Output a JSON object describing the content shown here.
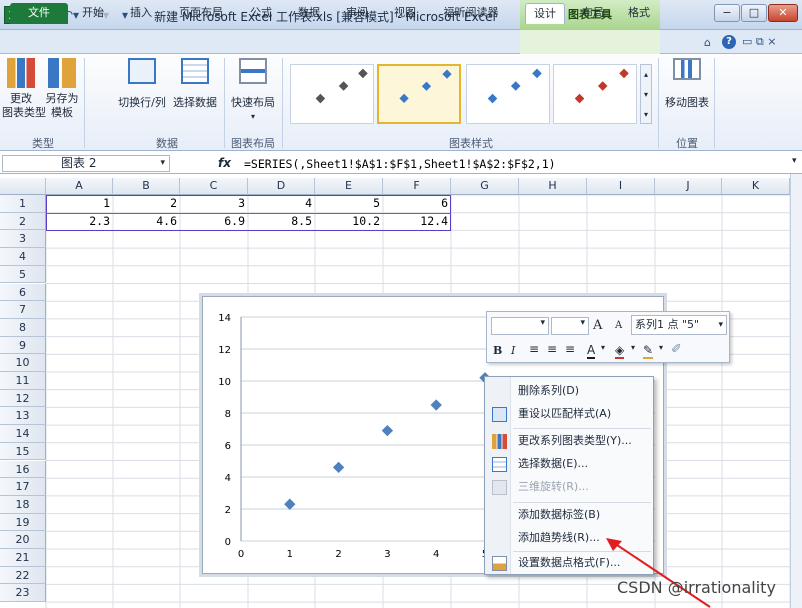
{
  "window": {
    "title": "新建 Microsoft Excel 工作表.xls  [兼容模式] - Microsoft Excel",
    "context_tools": "图表工具",
    "minimize": "−",
    "maximize": "□",
    "close": "✕"
  },
  "tabs": [
    {
      "label": "文件"
    },
    {
      "label": "开始"
    },
    {
      "label": "插入"
    },
    {
      "label": "页面布局"
    },
    {
      "label": "公式"
    },
    {
      "label": "数据"
    },
    {
      "label": "审阅"
    },
    {
      "label": "视图"
    },
    {
      "label": "福昕阅读器"
    },
    {
      "label": "设计"
    },
    {
      "label": "布局"
    },
    {
      "label": "格式"
    }
  ],
  "ribbon": {
    "change_type": "更改\n图表类型",
    "save_template": "另存为\n模板",
    "switch_rowcol": "切换行/列",
    "select_data": "选择数据",
    "quick_layout": "快速布局",
    "move_chart": "移动图表",
    "groups": {
      "type": "类型",
      "data": "数据",
      "layout": "图表布局",
      "styles": "图表样式",
      "location": "位置"
    }
  },
  "formula_bar": {
    "name_box": "图表 2",
    "fx": "fx",
    "formula": "=SERIES(,Sheet1!$A$1:$F$1,Sheet1!$A$2:$F$2,1)"
  },
  "sheet": {
    "columns": [
      "A",
      "B",
      "C",
      "D",
      "E",
      "F",
      "G",
      "H",
      "I",
      "J",
      "K"
    ],
    "rows": [
      "1",
      "2",
      "3",
      "4",
      "5",
      "6",
      "7",
      "8",
      "9",
      "10",
      "11",
      "12",
      "13",
      "14",
      "15",
      "16",
      "17",
      "18",
      "19",
      "20",
      "21",
      "22",
      "23"
    ],
    "row1": [
      "1",
      "2",
      "3",
      "4",
      "5",
      "6"
    ],
    "row2": [
      "2.3",
      "4.6",
      "6.9",
      "8.5",
      "10.2",
      "12.4"
    ]
  },
  "chart_data": {
    "type": "scatter",
    "series": [
      {
        "x": [
          1,
          2,
          3,
          4,
          5,
          6
        ],
        "y": [
          2.3,
          4.6,
          6.9,
          8.5,
          10.2,
          12.4
        ]
      }
    ],
    "xlim": [
      0,
      5
    ],
    "ylim": [
      0,
      14
    ],
    "x_ticks": [
      "0",
      "1",
      "2",
      "3",
      "4",
      "5"
    ],
    "y_ticks": [
      "0",
      "2",
      "4",
      "6",
      "8",
      "10",
      "12",
      "14"
    ],
    "grid": true,
    "color": "#4f81bd"
  },
  "mini_toolbar": {
    "series_label": "系列1 点 \"5\"",
    "bold": "B",
    "italic": "I",
    "grow": "A",
    "shrink": "A"
  },
  "context_menu": [
    {
      "label": "删除系列(D)",
      "enabled": true
    },
    {
      "label": "重设以匹配样式(A)",
      "enabled": true
    },
    {
      "label": "更改系列图表类型(Y)...",
      "enabled": true
    },
    {
      "label": "选择数据(E)...",
      "enabled": true
    },
    {
      "label": "三维旋转(R)...",
      "enabled": false
    },
    {
      "label": "添加数据标签(B)",
      "enabled": true
    },
    {
      "label": "添加趋势线(R)...",
      "enabled": true
    },
    {
      "label": "设置数据点格式(F)...",
      "enabled": true
    }
  ],
  "watermark": "CSDN @irrationality",
  "colors": {
    "accent": "#4f81bd",
    "file_tab": "#1e7a3b",
    "annotation_arrow": "#e02020"
  }
}
